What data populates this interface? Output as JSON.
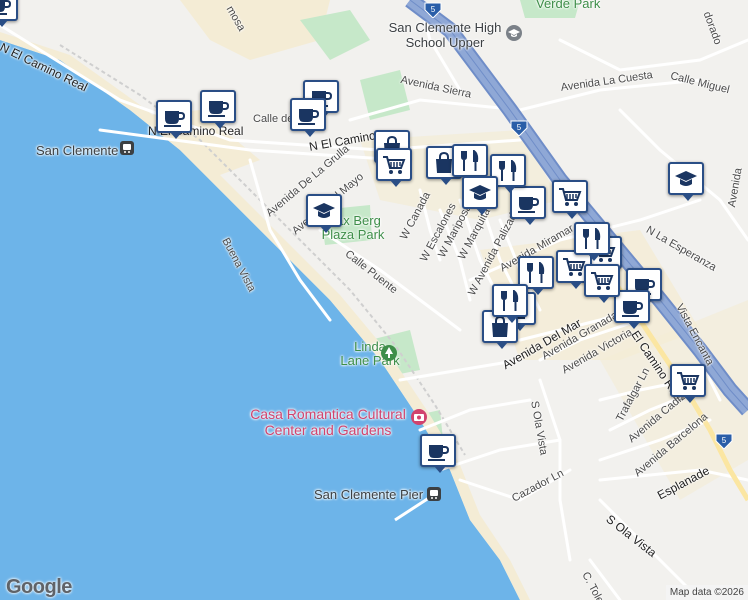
{
  "map": {
    "colors": {
      "land": "#f2f1ee",
      "water": "#6db4e9",
      "park": "#c6e8c9",
      "urban": "#f4ecd5",
      "highway": "#8fa8d6",
      "highway_edge": "#6f8dc8",
      "road": "#ffffff",
      "pin_border": "#2a4e86"
    },
    "labels": {
      "verde_park": "Verde Park",
      "high_school": "San Clemente High School Upper",
      "n_el_camino_real": "N El Camino Real",
      "n_el_camino_real_2": "N El Camino Real",
      "san_clemente": "San Clemente",
      "calle_miguel": "Calle Miguel",
      "avenida_la_cuesta": "Avenida La Cuesta",
      "avenida_sierra": "Avenida Sierra",
      "calle_de": "Calle de",
      "n_el_camino_short": "N El Camino",
      "avenida_de_la_grulla": "Avenida De La Grulla",
      "avenida_del_mayo": "Avenida Del Mayo",
      "max_berg_park": "Max Berg Plaza Park",
      "w_canada": "W Canada",
      "w_escalones": "W Escalones",
      "w_mariposa": "W Mariposa",
      "w_marquita": "W Marquita",
      "w_avenida_palizada": "W Avenida Palizada",
      "avenida_miramar": "Avenida Miramar",
      "n_la_esperanza": "N La Esperanza",
      "calle_puente": "Calle Puente",
      "buena_vista": "Buena Vista",
      "linda_lane_park": "Linda Lane Park",
      "avenida_del_mar": "Avenida Del Mar",
      "avenida_granada": "Avenida Granada",
      "avenida_victoria": "Avenida Victoria",
      "el_camino_real": "El Camino Real",
      "vista_encanta": "Vista Encanta",
      "casa_romantica": "Casa Romantica Cultural Center and Gardens",
      "s_ola_vista": "S Ola Vista",
      "s_ola_vista_2": "S Ola Vista",
      "trafalgar_ln": "Trafalgar Ln",
      "avenida_cadiz": "Avenida Cadiz",
      "avenida_barcelona": "Avenida Barcelona",
      "esplanade": "Esplanade",
      "cazador_ln": "Cazador Ln",
      "san_clemente_pier": "San Clemente Pier",
      "c_toledo": "C. Toledo",
      "avenida_partial": "Avenida",
      "dorado_partial": "dorado",
      "hermosa_partial": "mosa"
    },
    "interstate": "5",
    "google_logo": "Google",
    "attribution": "Map data ©2026"
  }
}
